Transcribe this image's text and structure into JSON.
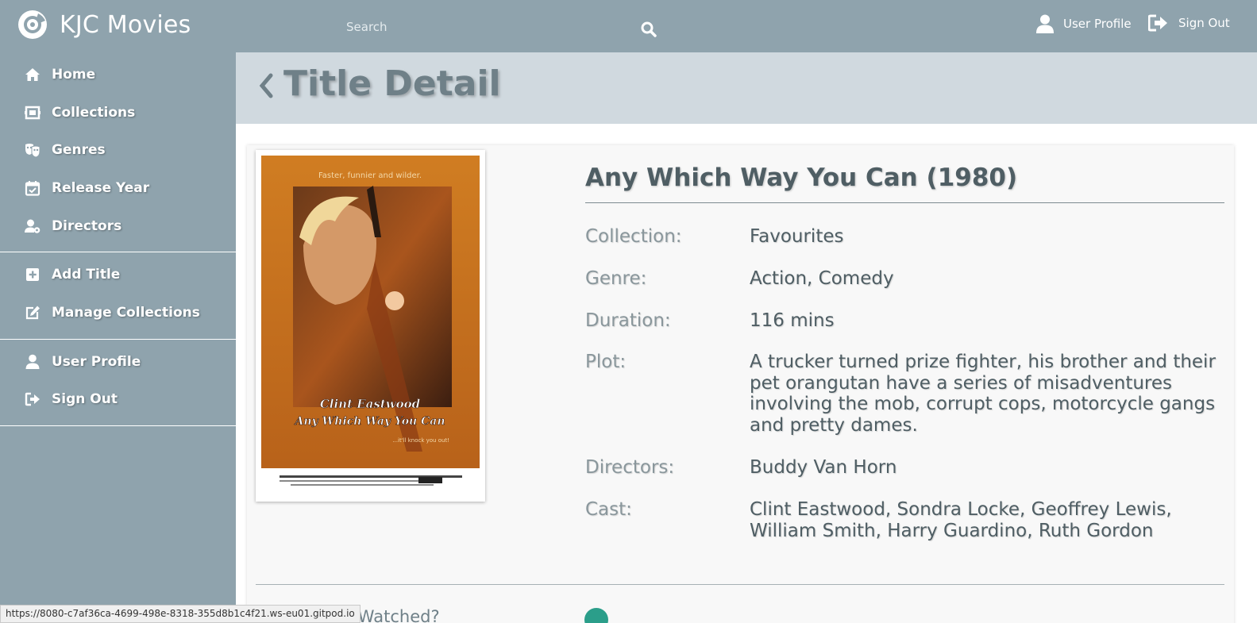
{
  "header": {
    "brand": "KJC Movies",
    "logo_icon": "film-reel-icon",
    "search_placeholder": "Search",
    "search_icon": "search-icon",
    "user_profile_label": "User Profile",
    "sign_out_label": "Sign Out"
  },
  "sidebar": {
    "groups": [
      [
        {
          "label": "Home",
          "icon": "home-icon"
        },
        {
          "label": "Collections",
          "icon": "collections-icon"
        },
        {
          "label": "Genres",
          "icon": "theater-masks-icon"
        },
        {
          "label": "Release Year",
          "icon": "calendar-check-icon"
        },
        {
          "label": "Directors",
          "icon": "user-cog-icon"
        }
      ],
      [
        {
          "label": "Add Title",
          "icon": "plus-square-icon"
        },
        {
          "label": "Manage Collections",
          "icon": "edit-icon"
        }
      ],
      [
        {
          "label": "User Profile",
          "icon": "user-icon"
        },
        {
          "label": "Sign Out",
          "icon": "sign-out-icon"
        }
      ]
    ]
  },
  "page": {
    "title": "Title Detail"
  },
  "movie": {
    "title": "Any Which Way You Can (1980)",
    "poster": {
      "tagline": "Faster, funnier and wilder.",
      "star": "Clint Eastwood",
      "title": "Any Which Way You Can",
      "subline": "...it'll knock you out!"
    },
    "details": [
      {
        "label": "Collection:",
        "value": "Favourites"
      },
      {
        "label": "Genre:",
        "value": "Action, Comedy"
      },
      {
        "label": "Duration:",
        "value": "116 mins"
      },
      {
        "label": "Plot:",
        "value": "A trucker turned prize fighter, his brother and their pet orangutan have a series of misadventures involving the mob, corrupt cops, motorcycle gangs and pretty dames."
      },
      {
        "label": "Directors:",
        "value": "Buddy Van Horn"
      },
      {
        "label": "Cast:",
        "value": "Clint Eastwood, Sondra Locke, Geoffrey Lewis, William Smith, Harry Guardino, Ruth Gordon"
      }
    ],
    "watched_label": "Is Watched?"
  },
  "status_bar": {
    "url": "https://8080-c7af36ca-4699-498e-8318-355d8b1c4f21.ws-eu01.gitpod.io"
  },
  "colors": {
    "header_bg": "#8fa3ad",
    "sidebar_bg": "#8fa3ad",
    "banner_bg": "#d0d9df",
    "title_text": "#6f8088",
    "toggle_accent": "#2b9e8a",
    "poster_orange": "#c8731a"
  }
}
